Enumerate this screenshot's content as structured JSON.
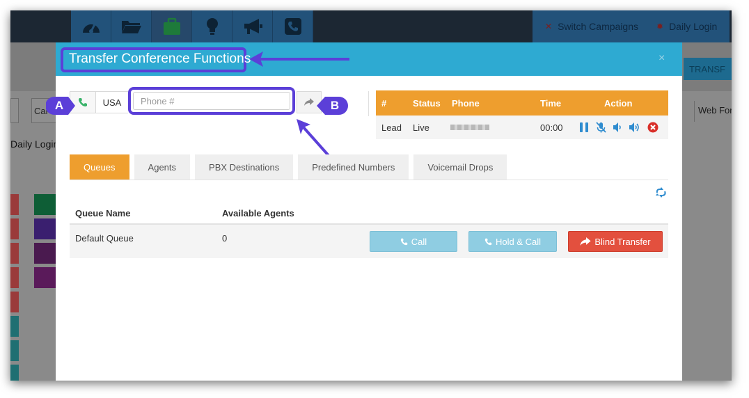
{
  "topbar": {
    "icons": [
      "dashboard-icon",
      "folder-icon",
      "briefcase-icon",
      "lightbulb-icon",
      "megaphone-icon",
      "phone-square-icon"
    ],
    "switch_campaigns": "Switch Campaigns",
    "daily_login": "Daily Login"
  },
  "background": {
    "cal_partial": "Cal",
    "daily_login": "Daily Login",
    "transfer_partial": "TRANSF",
    "web_form_partial": "Web For"
  },
  "modal": {
    "title": "Transfer Conference Functions",
    "close": "×"
  },
  "dialer": {
    "country": "USA",
    "phone_placeholder": "Phone #",
    "phone_value": ""
  },
  "callouts": {
    "a": "A",
    "b": "B"
  },
  "call_table": {
    "headers": {
      "num": "#",
      "status": "Status",
      "phone": "Phone",
      "time": "Time",
      "action": "Action"
    },
    "row": {
      "num": "Lead",
      "status": "Live",
      "phone": "",
      "time": "00:00"
    },
    "actions": [
      "pause-icon",
      "mute-mic-icon",
      "volume-down-icon",
      "volume-up-icon",
      "hangup-icon"
    ]
  },
  "tabs": [
    "Queues",
    "Agents",
    "PBX Destinations",
    "Predefined Numbers",
    "Voicemail Drops"
  ],
  "queues": {
    "headers": {
      "name": "Queue Name",
      "agents": "Available Agents"
    },
    "rows": [
      {
        "name": "Default Queue",
        "agents": "0"
      }
    ],
    "buttons": {
      "call": "Call",
      "hold_call": "Hold & Call",
      "blind_transfer": "Blind Transfer"
    }
  },
  "colors": {
    "header_blue": "#2eaad2",
    "accent_orange": "#ee9e2e",
    "callout_purple": "#5b3fd8",
    "call_button": "#8fcde2",
    "blind_transfer": "#e3503e"
  }
}
